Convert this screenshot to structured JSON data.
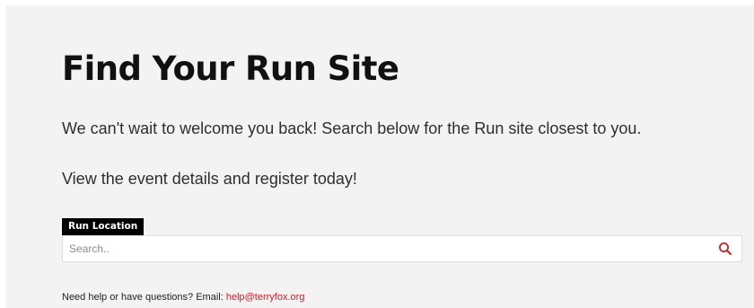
{
  "page": {
    "title": "Find Your Run Site",
    "intro": "We can't wait to welcome you back! Search below for the Run site closest to you.",
    "cta": "View the event details and register today!"
  },
  "search": {
    "label": "Run Location",
    "placeholder": "Search..",
    "value": "",
    "button_icon": "search-icon"
  },
  "help": {
    "prefix": "Need help or have questions? Email:",
    "email": "help@terryfox.org"
  },
  "colors": {
    "background": "#f3f3f3",
    "accent": "#c8222a",
    "label_bg": "#000000",
    "label_text": "#ffffff"
  }
}
